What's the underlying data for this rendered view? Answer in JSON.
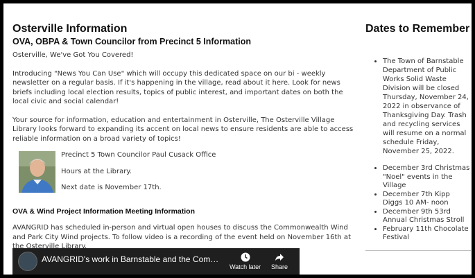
{
  "main": {
    "title": "Osterville Information",
    "subtitle": "OVA, OBPA & Town Councilor from Precinct 5 Information",
    "greeting": "Osterville, We've Got You Covered!",
    "intro": "Introducing \"News You Can Use\" which will occupy this dedicated space on our bi - weekly newsletter on a regular basis. If it's happening in the  village, read about it here. Look for news briefs including local election results, topics of public interest, and important dates on both the local civic and social calendar!",
    "source": "Your source for information, education and entertainment in Osterville, The Osterville Village Library looks forward to expanding its accent on local news to ensure residents are able to access reliable information on a broad variety of topics!",
    "office": {
      "name": "Precinct 5 Town Councilor Paul Cusack Office",
      "hours": "Hours at the Library.",
      "next": "Next date is November 17th."
    },
    "section_heading": "OVA & Wind Project Information Meeting Information",
    "section_text": "AVANGRID has scheduled in-person and virtual open houses to discuss the Commonwealth Wind and Park City Wind projects. To follow video is a recording of the event held on November 16th at the Osterville Library.",
    "video": {
      "title": "AVANGRID's work in Barnstable and the Common...",
      "watch_later": "Watch later",
      "share": "Share"
    }
  },
  "sidebar": {
    "title": "Dates to Remember",
    "items": [
      "The Town of Barnstable Department of Public Works Solid Waste Division will be closed Thursday, November 24, 2022 in observance of Thanksgiving Day. Trash and recycling services will resume on a normal schedule Friday, November 25, 2022.",
      "December 3rd Christmas \"Noel\" events in the Village",
      "December 7th Kipp Diggs 10 AM- noon",
      "December 9th 53rd Annual Christmas Stroll",
      "February 11th Chocolate Festival"
    ]
  },
  "colors": {
    "frame": "#000000",
    "background": "#ffffff",
    "text": "#333333",
    "video_bg": "#1f1f1f"
  },
  "icons": [
    "clock-icon",
    "share-icon",
    "channel-avatar-icon",
    "person-photo"
  ]
}
